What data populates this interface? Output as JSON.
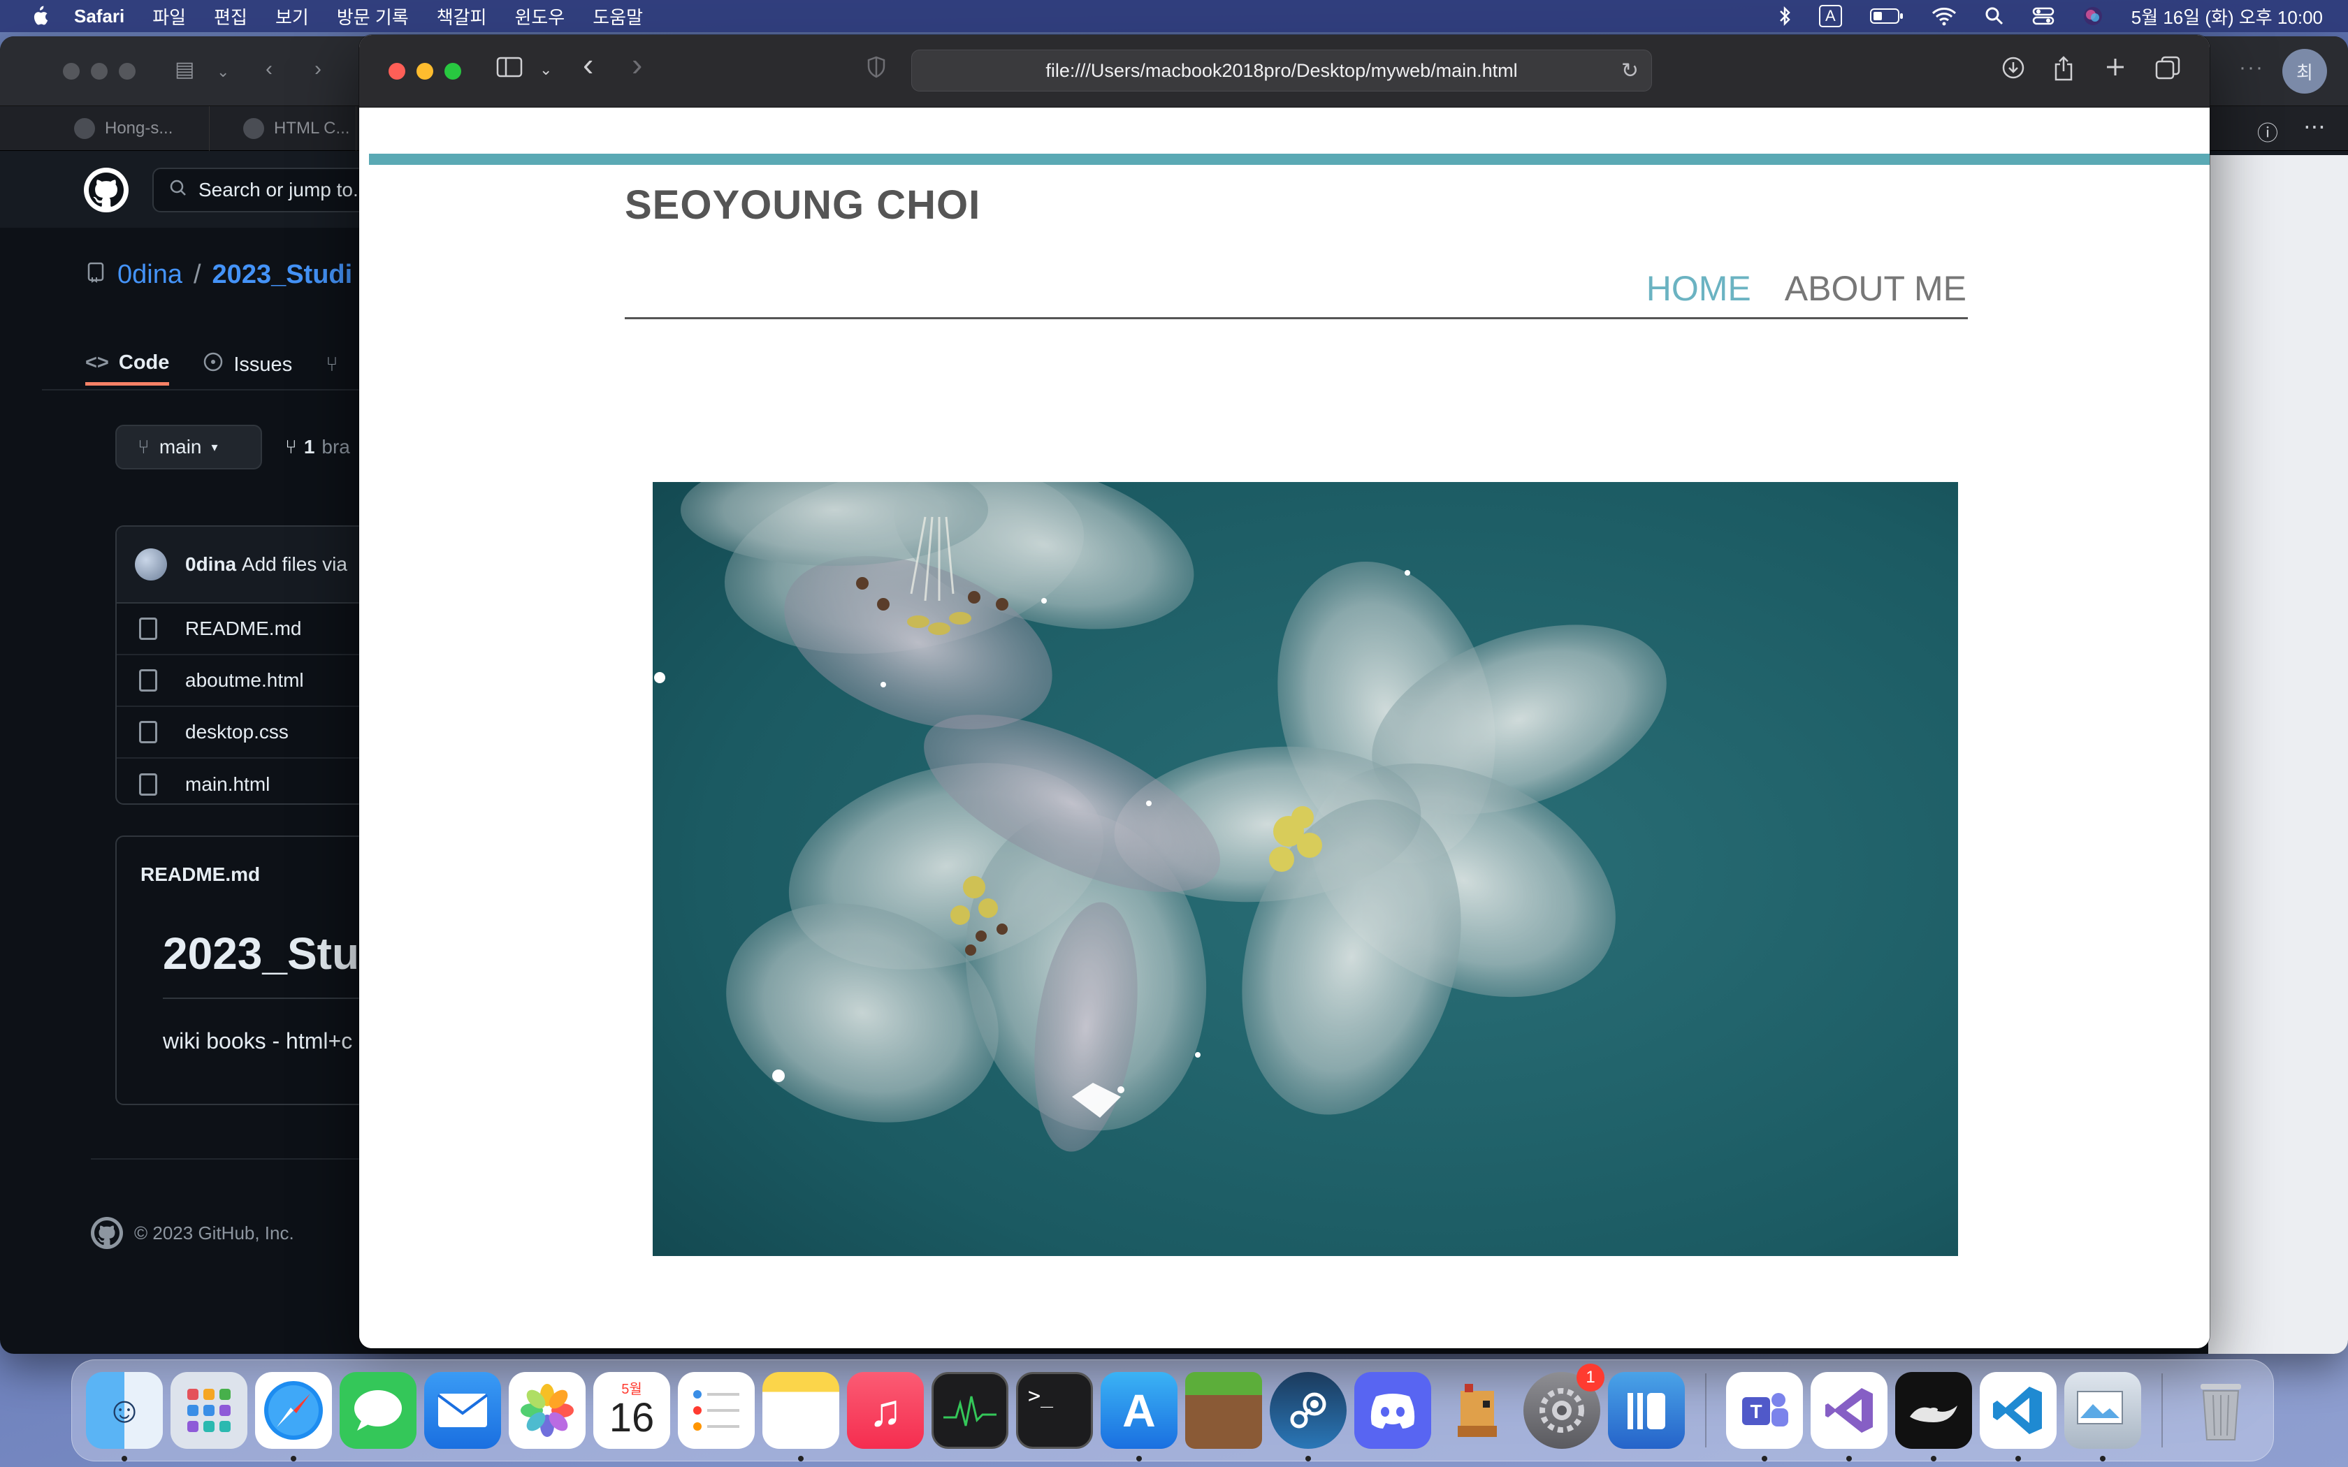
{
  "menubar": {
    "app_name": "Safari",
    "items": [
      "파일",
      "편집",
      "보기",
      "방문 기록",
      "책갈피",
      "윈도우",
      "도움말"
    ],
    "input_source": "A",
    "clock": "5월 16일 (화) 오후 10:00"
  },
  "bg_window": {
    "tabs": [
      "Hong-s...",
      "HTML C..."
    ],
    "avatar": "최",
    "search_placeholder": "Search or jump to...",
    "owner": "0dina",
    "slash": "/",
    "repo": "2023_Studi",
    "repo_tabs": [
      "Code",
      "Issues"
    ],
    "branch": "main",
    "branch_count": "1",
    "branch_word": "bra",
    "commit_author": "0dina",
    "commit_message": "Add files via",
    "files": [
      "README.md",
      "aboutme.html",
      "desktop.css",
      "main.html"
    ],
    "readme_header": "README.md",
    "readme_title": "2023_Stu",
    "readme_text": "wiki books - html+c",
    "footer": "© 2023 GitHub, Inc."
  },
  "safari": {
    "url": "file:///Users/macbook2018pro/Desktop/myweb/main.html"
  },
  "site": {
    "title": "SEOYOUNG CHOI",
    "nav_home": "HOME",
    "nav_about": "ABOUT ME",
    "accent_color": "#5aa9b4"
  },
  "dock": {
    "calendar_month": "5월",
    "calendar_day": "16",
    "settings_badge": "1",
    "apps": [
      "finder-icon",
      "launchpad-icon",
      "safari-icon",
      "messages-icon",
      "mail-icon",
      "photos-icon",
      "calendar-icon",
      "reminders-icon",
      "notes-icon",
      "music-icon",
      "activity-monitor-icon",
      "terminal-icon",
      "app-store-icon",
      "minecraft-icon",
      "steam-icon",
      "discord-icon",
      "stardew-icon",
      "system-settings-icon",
      "korean-app-icon",
      "teams-icon",
      "visual-studio-icon",
      "aladdin-icon",
      "vscode-icon",
      "preview-icon",
      "trash-icon"
    ]
  }
}
